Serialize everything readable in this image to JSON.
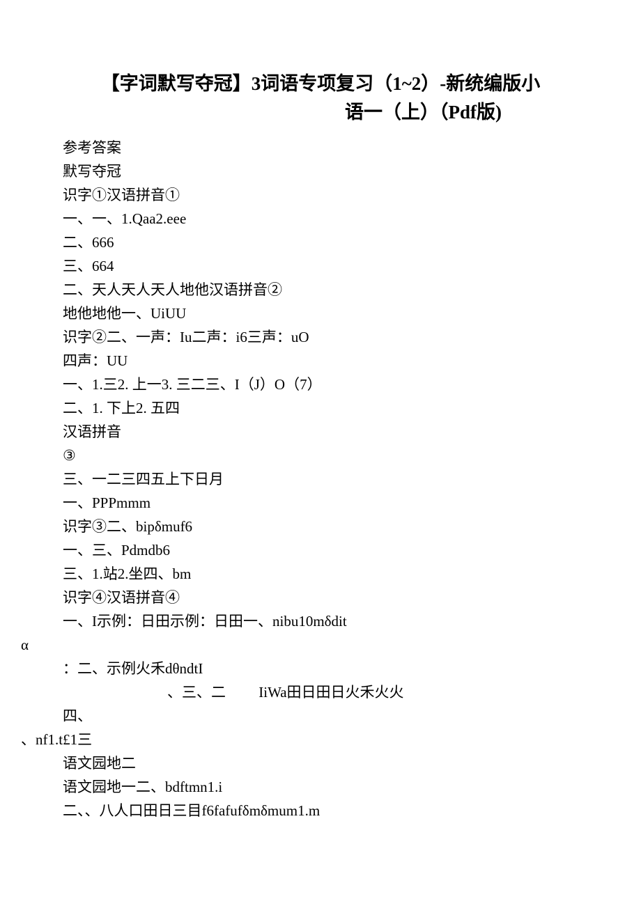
{
  "title": {
    "line1": "【字词默写夺冠】3词语专项复习（1~2）-新统编版小",
    "line2": "语一（上）（Pdf版)"
  },
  "lines": [
    {
      "text": "参考答案",
      "cls": ""
    },
    {
      "text": "默写夺冠",
      "cls": ""
    },
    {
      "text": "识字①汉语拼音①",
      "cls": ""
    },
    {
      "text": "一、一、1.Qaa2.eee",
      "cls": ""
    },
    {
      "text": "二、666",
      "cls": ""
    },
    {
      "text": "三、664",
      "cls": ""
    },
    {
      "text": "二、天人天人天人地他汉语拼音②",
      "cls": ""
    },
    {
      "text": "地他地他一、UiUU",
      "cls": ""
    },
    {
      "text": "识字②二、一声：Iu二声：i6三声：uO",
      "cls": ""
    },
    {
      "text": "四声：UU",
      "cls": ""
    },
    {
      "text": "一、1.三2. 上一3. 三二三、I（J）O（7）",
      "cls": ""
    },
    {
      "text": "二、1. 下上2. 五四",
      "cls": ""
    },
    {
      "text": "汉语拼音",
      "cls": ""
    },
    {
      "text": "③",
      "cls": ""
    },
    {
      "text": "三、一二三四五上下日月",
      "cls": ""
    },
    {
      "text": "一、PPPmmm",
      "cls": ""
    },
    {
      "text": "识字③二、bipδmuf6",
      "cls": ""
    },
    {
      "text": "一、三、Pdmdb6",
      "cls": ""
    },
    {
      "text": "三、1.站2.坐四、bm",
      "cls": ""
    },
    {
      "text": "识字④汉语拼音④",
      "cls": ""
    },
    {
      "text": "一、I示例：日田示例：日田一、nibu10mδdit",
      "cls": ""
    },
    {
      "text": "α",
      "cls": "outdent1"
    },
    {
      "text": "：二、示例火禾dθndtI",
      "cls": ""
    },
    {
      "text": "、三、二         IiWa田日田日火禾火火",
      "cls": "indent-nested"
    },
    {
      "text": "四、",
      "cls": ""
    },
    {
      "text": "、nf1.t£1三",
      "cls": "outdent1"
    },
    {
      "text": "语文园地二",
      "cls": ""
    },
    {
      "text": "语文园地一二、bdftmn1.i",
      "cls": ""
    },
    {
      "text": "二、、八人口田日三目f6fafufδmδmum1.m",
      "cls": ""
    }
  ]
}
